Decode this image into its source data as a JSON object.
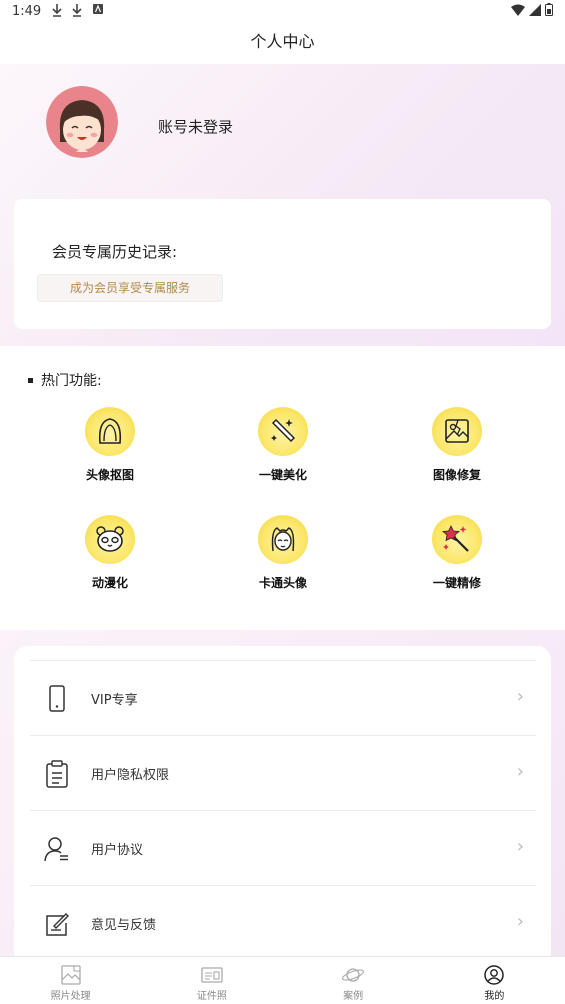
{
  "status_bar": {
    "time": "1:49"
  },
  "header": {
    "title": "个人中心"
  },
  "profile": {
    "login_status": "账号未登录"
  },
  "history": {
    "title": "会员专属历史记录:",
    "member_button": "成为会员享受专属服务"
  },
  "features": {
    "title": "热门功能:",
    "items": [
      {
        "label": "头像抠图",
        "icon": "hair-silhouette-icon"
      },
      {
        "label": "一键美化",
        "icon": "magic-wand-icon"
      },
      {
        "label": "图像修复",
        "icon": "image-repair-icon"
      },
      {
        "label": "动漫化",
        "icon": "panda-icon"
      },
      {
        "label": "卡通头像",
        "icon": "cartoon-girl-icon"
      },
      {
        "label": "一键精修",
        "icon": "star-wand-icon"
      }
    ]
  },
  "menu": {
    "items": [
      {
        "label": "VIP专享",
        "icon": "phone-icon"
      },
      {
        "label": "用户隐私权限",
        "icon": "clipboard-icon"
      },
      {
        "label": "用户协议",
        "icon": "user-doc-icon"
      },
      {
        "label": "意见与反馈",
        "icon": "edit-icon"
      }
    ]
  },
  "tab_bar": {
    "tabs": [
      {
        "label": "照片处理",
        "icon": "photo-icon"
      },
      {
        "label": "证件照",
        "icon": "id-card-icon"
      },
      {
        "label": "案例",
        "icon": "planet-icon"
      },
      {
        "label": "我的",
        "icon": "user-circle-icon",
        "active": true
      }
    ]
  }
}
